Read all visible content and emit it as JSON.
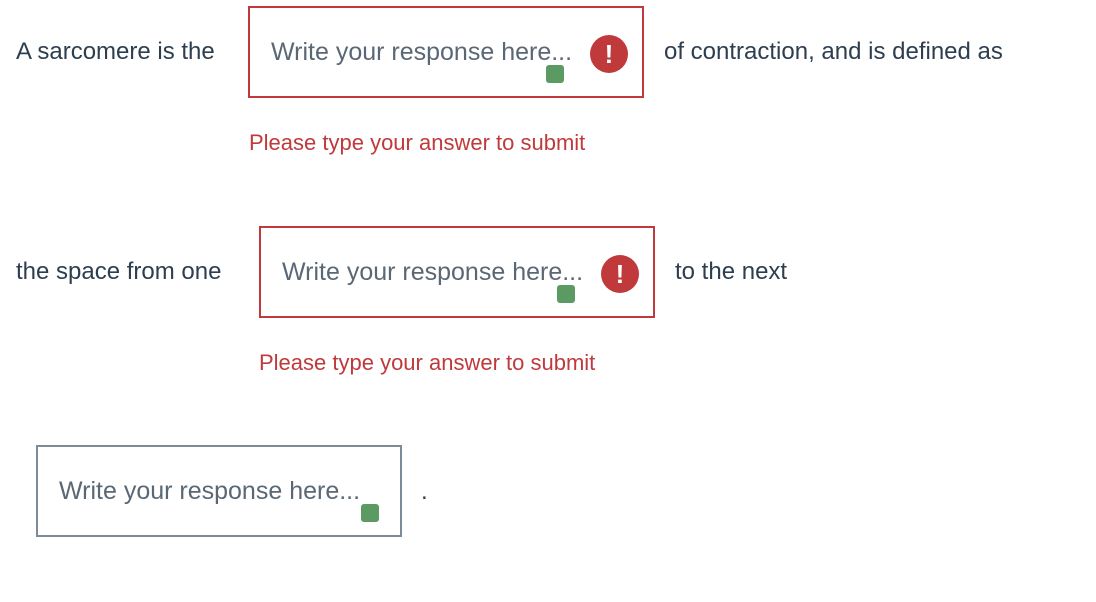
{
  "sentence": {
    "line1_prefix": "A sarcomere is the",
    "line1_suffix": "of contraction, and is defined as",
    "line2_prefix": "the space from one",
    "line2_suffix": "to the next",
    "line3_suffix": "."
  },
  "blanks": [
    {
      "placeholder": "Write your response here...",
      "error": "Please type your answer to submit",
      "alert_glyph": "!"
    },
    {
      "placeholder": "Write your response here...",
      "error": "Please type your answer to submit",
      "alert_glyph": "!"
    },
    {
      "placeholder": "Write your response here..."
    }
  ],
  "colors": {
    "error": "#c0393b",
    "neutral_border": "#7d8c99",
    "handle": "#5b9a63",
    "text": "#2d3e50"
  },
  "icons": {
    "alert": "exclamation-circle-icon",
    "resize": "green-square-handle-icon"
  }
}
